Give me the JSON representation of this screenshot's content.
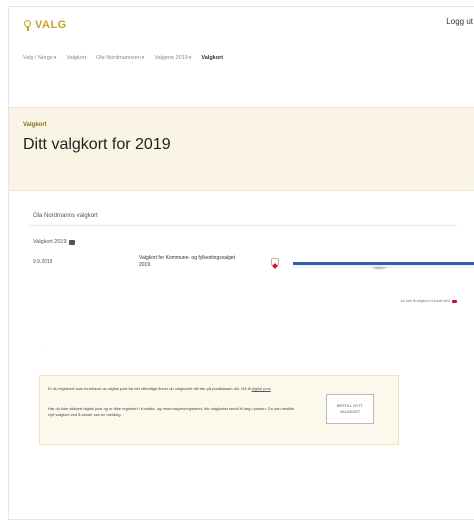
{
  "header": {
    "logo_text": "VALG",
    "login_label": "Logg ut"
  },
  "nav": {
    "items": [
      {
        "label": "Valg i Norge",
        "dropdown": true
      },
      {
        "label": "Valgkort",
        "dropdown": false
      },
      {
        "label": "Ole Nordmannsen",
        "dropdown": true
      },
      {
        "label": "Valgene 2019",
        "dropdown": true
      },
      {
        "label": "Valgkort",
        "dropdown": false,
        "active": true
      }
    ]
  },
  "hero": {
    "kicker": "Valgkort",
    "title": "Ditt valgkort for 2019"
  },
  "card": {
    "title": "Ola Nordmanns valgkort",
    "valg_label": "Valgkort 2019",
    "row": {
      "date": "9.9.2019",
      "name": "Valgkort for Kommune- og fylkestingsvalget 2019",
      "progress_text": "Valgkort",
      "progress_fraction": 1.0
    },
    "hint": "Du kan få valgkort et annet sted"
  },
  "faint_text": "...",
  "notice": {
    "p1": "Er du registrert som innehaver av digital post fra det offentlige finner du valgkortet ditt der på postkassen din. Gå til",
    "p1_link": "digital post",
    "p2": "Har du ikke aktivert digital post og er ikke registrert i Kontakt- og reservasjonsregisteret, blir valgkortet sendt til deg i posten. Du kan bestille nytt valgkort ved å sende oss en melding.",
    "button_label": "BESTILL NYTT VALGKORT"
  },
  "colors": {
    "accent": "#c9a227",
    "hero_bg": "#faf4e6",
    "progress": "#2e5fb5",
    "alert": "#c8102e"
  },
  "icons": [
    "ballot-logo-icon",
    "chevron-down-icon",
    "print-icon",
    "valgkort-status-icon",
    "info-badge-icon"
  ]
}
